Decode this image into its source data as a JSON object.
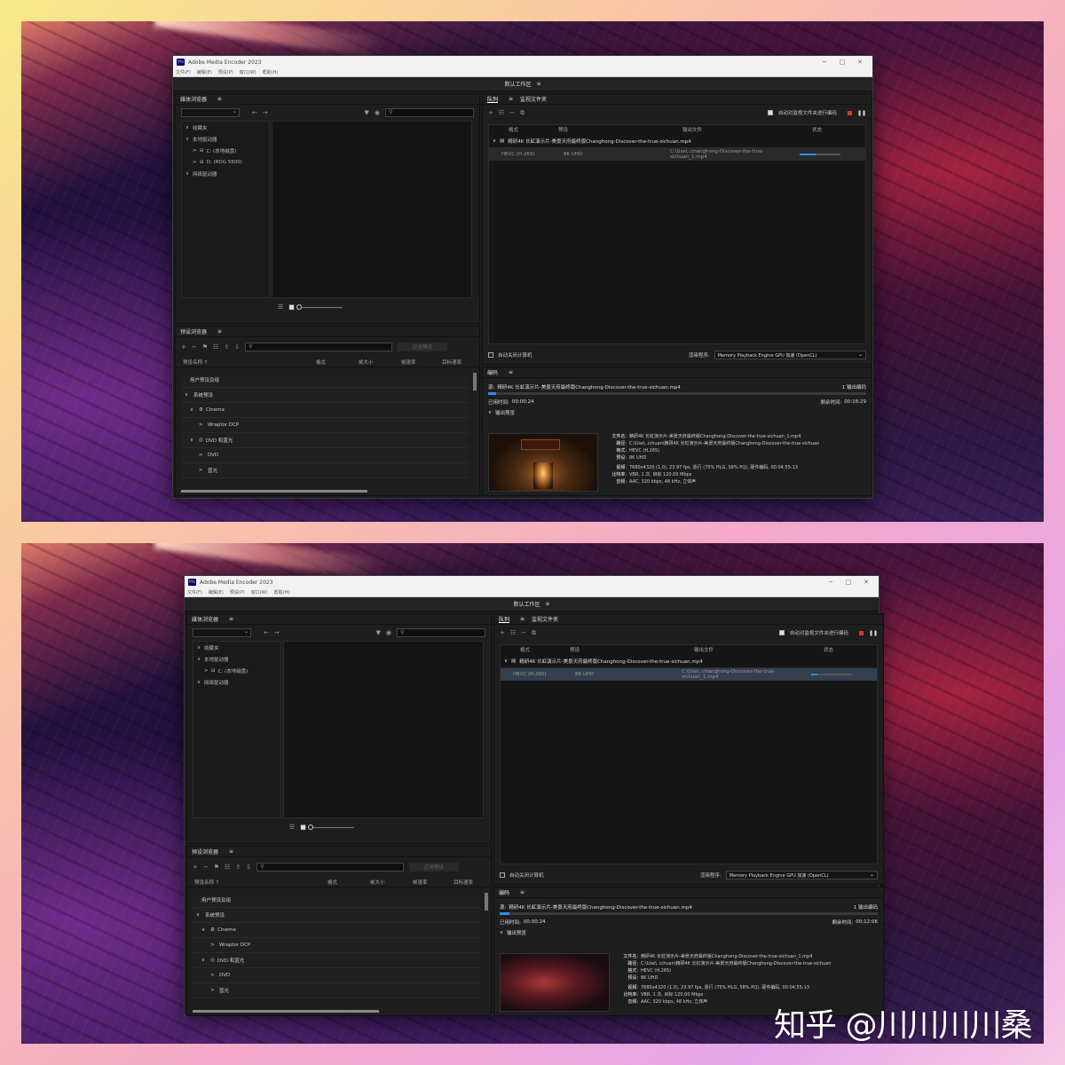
{
  "app": {
    "title": "Adobe Media Encoder 2023",
    "logo": "Me",
    "menu": [
      "文件(F)",
      "编辑(E)",
      "预设(P)",
      "窗口(W)",
      "帮助(H)"
    ],
    "workspace": "默认工作区",
    "workspace_menu_icon": "≡"
  },
  "media_browser": {
    "title": "媒体浏览器",
    "menu_icon": "≡",
    "search_placeholder": "",
    "tree_top": [
      {
        "arrow": "∨",
        "label": "收藏夹"
      },
      {
        "arrow": "∨",
        "label": "本地驱动器"
      },
      {
        "arrow": ">",
        "label": "C: (本地磁盘)"
      },
      {
        "arrow": ">",
        "label": "D: (ROG 5500)"
      },
      {
        "arrow": "∨",
        "label": "网络驱动器"
      }
    ],
    "tree_bottom": [
      {
        "arrow": "∨",
        "label": "收藏夹"
      },
      {
        "arrow": "∨",
        "label": "本地驱动器"
      },
      {
        "arrow": ">",
        "label": "C: (本地磁盘)"
      },
      {
        "arrow": "∨",
        "label": "网络驱动器"
      }
    ]
  },
  "preset_browser": {
    "title": "预设浏览器",
    "menu_icon": "≡",
    "apply_button": "应用预设",
    "columns": [
      "预设名称 ↑",
      "格式",
      "帧大小",
      "帧速率",
      "目标速率"
    ],
    "rows": [
      {
        "arrow": "",
        "label": "用户预设及组"
      },
      {
        "arrow": "∨",
        "label": "系统预设"
      },
      {
        "arrow": "∨",
        "label": "Cinema"
      },
      {
        "arrow": ">",
        "label": "Wraptor DCP"
      },
      {
        "arrow": "∨",
        "label": "DVD 和蓝光"
      },
      {
        "arrow": ">",
        "label": "DVD"
      },
      {
        "arrow": ">",
        "label": "蓝光"
      }
    ]
  },
  "queue": {
    "tab_queue": "队列",
    "tab_watch": "监视文件夹",
    "menu_icon": "≡",
    "auto_encode_label": "自动对监视文件夹进行编码",
    "columns": [
      "格式",
      "预设",
      "输出文件",
      "状态"
    ],
    "source_name": "精研4K 长虹演示片-美景天府最终版Changhong-Discover-the-true-sichuan.mp4",
    "output": {
      "format": "HEVC (H.265)",
      "preset": "8K UHD",
      "file": "C:\\Use\\..changhong-Discover-the-true-sichuan_1.mp4"
    },
    "progress_top": 0.4,
    "progress_bottom": 0.15,
    "shutdown_label": "自动关闭计算机",
    "renderer_label": "渲染程序:",
    "renderer_value": "Memory Playback Engine GPU 加速 (OpenCL)"
  },
  "encoding": {
    "title": "编码",
    "menu_icon": "≡",
    "file_prefix": "源:",
    "file_line": "精研4K 长虹演示片-美景天府最终版Changhong-Discover-the-true-sichuan.mp4",
    "outputs_count": "1 输出编码",
    "elapsed_label": "已用时间:",
    "elapsed_top": "00:00:24",
    "elapsed_bottom": "00:00:24",
    "remaining_label": "剩余时间:",
    "remaining_top": "00:16:29",
    "remaining_bottom": "00:12:06",
    "progress_top": 0.02,
    "progress_bottom": 0.025,
    "output_preview": "输出预览",
    "meta": {
      "filename_label": "文件名:",
      "filename_value": "精研4K 长虹演示片-美景天府最终版Changhong-Discover-the-true-sichuan_1.mp4",
      "path_label": "路径:",
      "path_value": "C:\\Use\\..ichuan\\精研4K 长虹演示片-美景天府最终版Changhong-Discover-the-true-sichuan",
      "format_label": "格式:",
      "format_value": "HEVC (H.265)",
      "preset_label": "预设:",
      "preset_value": "8K UHD",
      "video_label": "视频:",
      "video_value": "7680x4320 (1.0), 23.97 fps, 逐行 (75% HLG, 58% PQ), 硬件编码, 00:04:55:13",
      "bitrate_label": "比特率:",
      "bitrate_value": "VBR, 1 次, 目标 120.00 Mbps",
      "audio_label": "音频:",
      "audio_value": "AAC, 320 kbps, 48 kHz, 立体声"
    }
  },
  "watermark": "知乎 @川川川川桑",
  "colors": {
    "accent": "#2d8ceb",
    "stop": "#e0342a",
    "panel_bg": "#1e1e1e"
  }
}
